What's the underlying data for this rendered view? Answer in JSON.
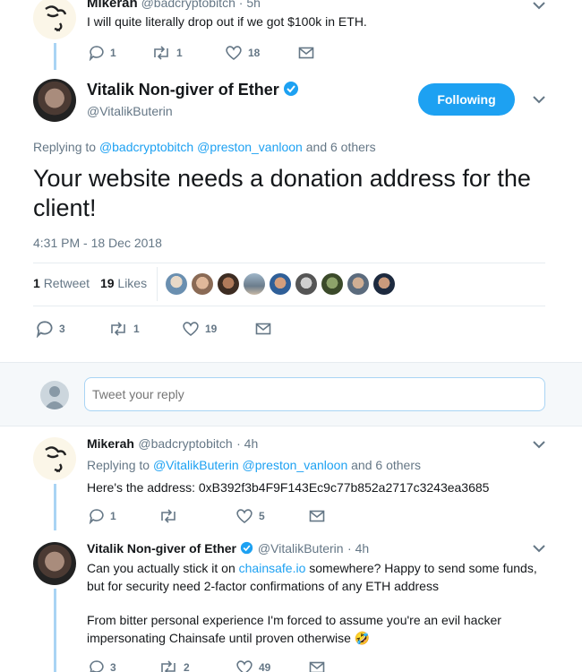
{
  "tweet_top": {
    "author_name": "Mikerah",
    "author_handle": "@badcryptobitch",
    "time": "· 5h",
    "text": "I will quite literally drop out if we got $100k in ETH.",
    "replies": "1",
    "retweets": "1",
    "likes": "18"
  },
  "main_tweet": {
    "author_name": "Vitalik Non-giver of Ether",
    "author_handle": "@VitalikButerin",
    "follow_button": "Following",
    "replying_prefix": "Replying to",
    "replying_to_1": "@badcryptobitch",
    "replying_to_2": "@preston_vanloon",
    "replying_suffix": "and 6 others",
    "text": "Your website needs a donation address for the client!",
    "timestamp": "4:31 PM - 18 Dec 2018",
    "retweet_count": "1",
    "retweet_label": "Retweet",
    "like_count": "19",
    "like_label": "Likes",
    "replies": "3",
    "retweets": "1",
    "likes": "19"
  },
  "reply_box": {
    "placeholder": "Tweet your reply"
  },
  "reply_1": {
    "author_name": "Mikerah",
    "author_handle": "@badcryptobitch",
    "time": "· 4h",
    "replying_prefix": "Replying to",
    "replying_to_1": "@VitalikButerin",
    "replying_to_2": "@preston_vanloon",
    "replying_suffix": "and 6 others",
    "text": "Here's the address: 0xB392f3b4F9F143Ec9c77b852a2717c3243ea3685",
    "replies": "1",
    "retweets": "",
    "likes": "5"
  },
  "reply_2": {
    "author_name": "Vitalik Non-giver of Ether",
    "author_handle": "@VitalikButerin",
    "time": "· 4h",
    "text_before_link": "Can you actually stick it on",
    "link": "chainsafe.io",
    "text_after_link": "somewhere? Happy to send some funds,",
    "text_line2": "but for security need 2-factor confirmations of any ETH address",
    "text_para2_line1": "From bitter personal experience I'm forced to assume you're an evil hacker",
    "text_para2_line2": "impersonating Chainsafe until proven otherwise",
    "emoji": "🤣",
    "replies": "3",
    "retweets": "2",
    "likes": "49"
  },
  "colors": {
    "accent": "#1da1f2",
    "thread_line": "#a9d4f4",
    "muted": "#657786",
    "divider": "#e6ecf0"
  }
}
